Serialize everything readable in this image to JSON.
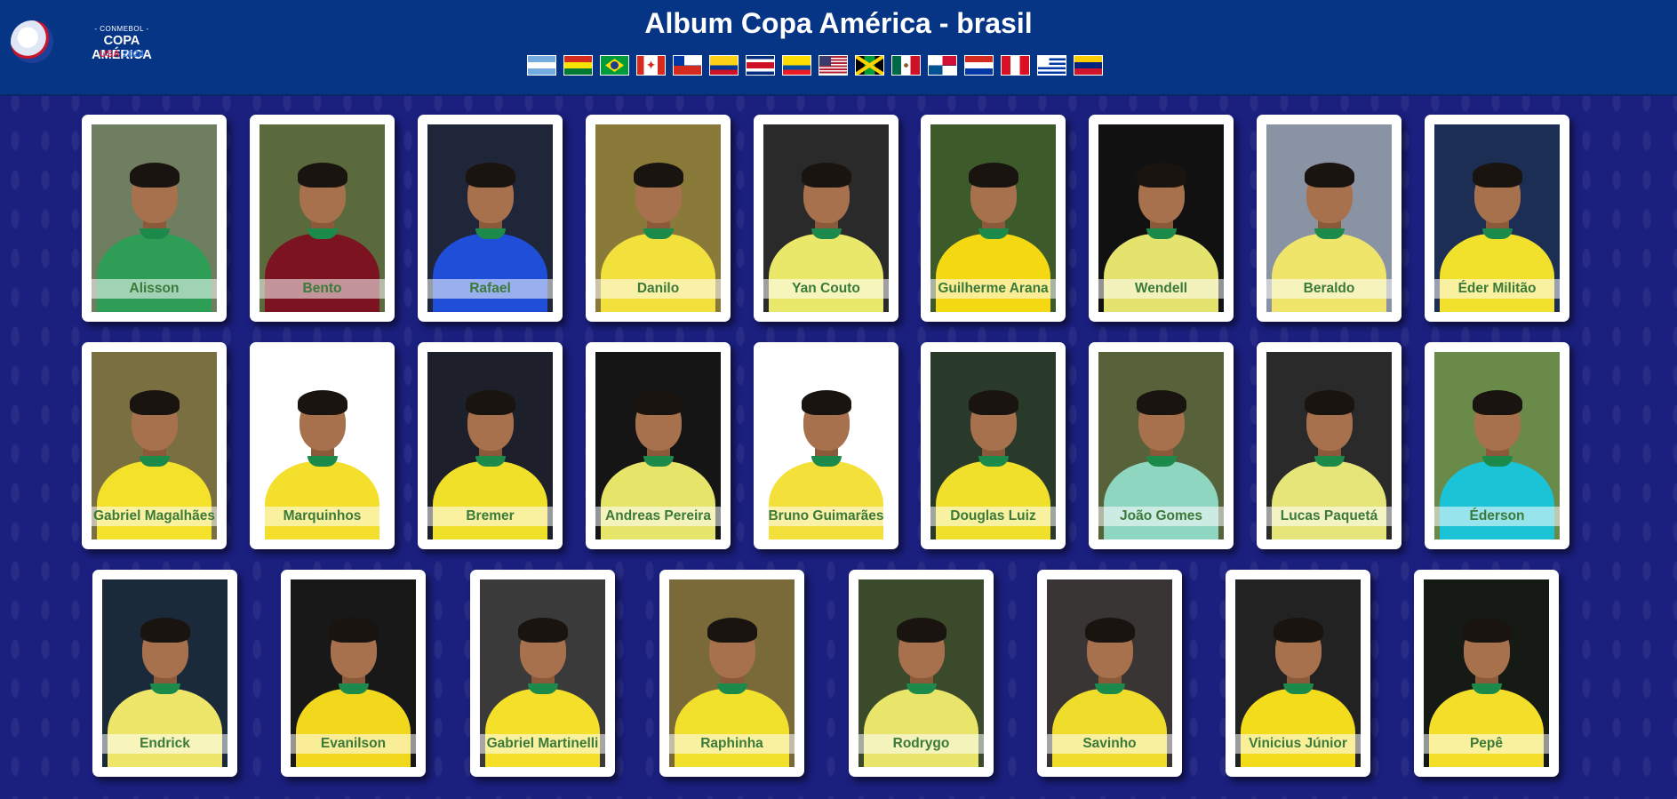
{
  "header": {
    "logo_small": "- CONMEBOL -",
    "logo_main": "COPA AMÉRICA",
    "logo_usa": "USA",
    "logo_year": "2024",
    "title": "Album Copa América - brasil"
  },
  "flags": [
    {
      "country": "argentina",
      "icon": "argentina-flag-icon"
    },
    {
      "country": "bolivia",
      "icon": "bolivia-flag-icon"
    },
    {
      "country": "brasil",
      "icon": "brazil-flag-icon"
    },
    {
      "country": "canada",
      "icon": "canada-flag-icon"
    },
    {
      "country": "chile",
      "icon": "chile-flag-icon"
    },
    {
      "country": "colombia",
      "icon": "colombia-flag-icon"
    },
    {
      "country": "costa rica",
      "icon": "costa-rica-flag-icon"
    },
    {
      "country": "ecuador",
      "icon": "ecuador-flag-icon"
    },
    {
      "country": "usa",
      "icon": "usa-flag-icon"
    },
    {
      "country": "jamaica",
      "icon": "jamaica-flag-icon"
    },
    {
      "country": "mexico",
      "icon": "mexico-flag-icon"
    },
    {
      "country": "panama",
      "icon": "panama-flag-icon"
    },
    {
      "country": "paraguay",
      "icon": "paraguay-flag-icon"
    },
    {
      "country": "peru",
      "icon": "peru-flag-icon"
    },
    {
      "country": "uruguay",
      "icon": "uruguay-flag-icon"
    },
    {
      "country": "venezuela",
      "icon": "venezuela-flag-icon"
    }
  ],
  "players": [
    {
      "name": "Alisson",
      "shirt": "#2e9e57",
      "bg": "#6f7d60"
    },
    {
      "name": "Bento",
      "shirt": "#7b1420",
      "bg": "#5a6a3c"
    },
    {
      "name": "Rafael",
      "shirt": "#1f4ed8",
      "bg": "#20263a"
    },
    {
      "name": "Danilo",
      "shirt": "#f2e13c",
      "bg": "#8a7a3a"
    },
    {
      "name": "Yan Couto",
      "shirt": "#e9e86a",
      "bg": "#2a2a2a"
    },
    {
      "name": "Guilherme Arana",
      "shirt": "#f4d812",
      "bg": "#3d5a2a"
    },
    {
      "name": "Wendell",
      "shirt": "#e4e36e",
      "bg": "#111111"
    },
    {
      "name": "Beraldo",
      "shirt": "#eee56a",
      "bg": "#8a93a3"
    },
    {
      "name": "Éder Militão",
      "shirt": "#f2e12c",
      "bg": "#1d2e55"
    },
    {
      "name": "Gabriel Magalhães",
      "shirt": "#f3e12a",
      "bg": "#7a6f40"
    },
    {
      "name": "Marquinhos",
      "shirt": "#f4e02c",
      "bg": "#ffffff"
    },
    {
      "name": "Bremer",
      "shirt": "#f1e02a",
      "bg": "#1d1f2a"
    },
    {
      "name": "Andreas Pereira",
      "shirt": "#e7e46a",
      "bg": "#151515"
    },
    {
      "name": "Bruno Guimarães",
      "shirt": "#f3e03a",
      "bg": "#ffffff"
    },
    {
      "name": "Douglas Luiz",
      "shirt": "#f0e02c",
      "bg": "#2a3a2a"
    },
    {
      "name": "João Gomes",
      "shirt": "#8fd6c0",
      "bg": "#58623a"
    },
    {
      "name": "Lucas Paquetá",
      "shirt": "#e6e57a",
      "bg": "#2a2a2a"
    },
    {
      "name": "Éderson",
      "shirt": "#1ac3d6",
      "bg": "#6a8a4a"
    },
    {
      "name": "Endrick",
      "shirt": "#eee66a",
      "bg": "#1a2a3a"
    },
    {
      "name": "Evanilson",
      "shirt": "#f2d81c",
      "bg": "#181818"
    },
    {
      "name": "Gabriel Martinelli",
      "shirt": "#f4e02a",
      "bg": "#3a3a3a"
    },
    {
      "name": "Raphinha",
      "shirt": "#f2e12c",
      "bg": "#7a6a3a"
    },
    {
      "name": "Rodrygo",
      "shirt": "#e9e46a",
      "bg": "#3a4a2a"
    },
    {
      "name": "Savinho",
      "shirt": "#f0dc2a",
      "bg": "#3a3535"
    },
    {
      "name": "Vinicius Júnior",
      "shirt": "#f2dc1c",
      "bg": "#222222"
    },
    {
      "name": "Pepê",
      "shirt": "#f3df2a",
      "bg": "#151a15"
    }
  ]
}
